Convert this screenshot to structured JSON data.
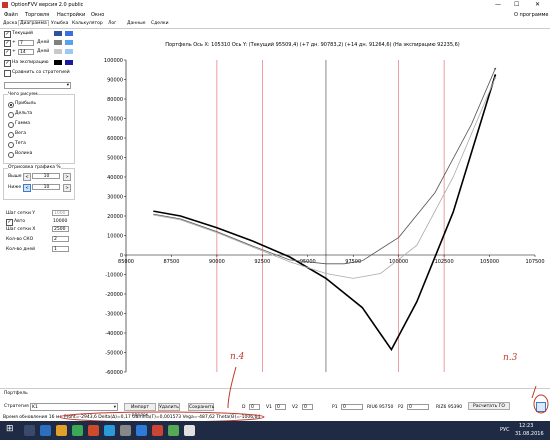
{
  "window": {
    "title": "OptionFVV версия 2.0 public",
    "minimize": "—",
    "maximize": "☐",
    "close": "✕"
  },
  "menu": {
    "items": [
      "Файл",
      "Торговля",
      "Настройки",
      "Окно"
    ],
    "about": "О программе"
  },
  "tabs": [
    "Доска",
    "Диаграмма",
    "Улыбка",
    "Калькулятор",
    "Лог",
    "Данные",
    "Сделки"
  ],
  "left_panel": {
    "current_label": "Текущий",
    "plus1": "+",
    "days1_value": "7",
    "days1_label": "Дней",
    "plus2": "+",
    "days2_value": "14",
    "days2_label": "Дней",
    "expiry_label": "На экспирацию",
    "compare_label": "Сравнить со стратегией",
    "whatdraw_label": "Чего рисуем",
    "radio_options": [
      "Прибыль",
      "Дельта",
      "Гамма",
      "Вега",
      "Тета",
      "Волина"
    ],
    "selected_radio": "Прибыль",
    "trim_label": "Отрисовка графика %",
    "above_label": "Выше",
    "above_value": "10",
    "below_label": "Ниже",
    "below_value": "10",
    "grid_y_label": "Шаг сетки Y",
    "grid_y_value": "1000",
    "auto_label": "Авто",
    "auto_value": "10000",
    "grid_x_label": "Шаг сетки X",
    "grid_x_value": "2500",
    "std_label": "Кол-во СКО",
    "std_value": "2",
    "days_count_label": "Кол-во дней",
    "days_count_value": "1",
    "colors": {
      "current": "#2f4f9f",
      "d7": "#7f7f7f",
      "d14": "#c8c8c8",
      "expiry": "#000000"
    }
  },
  "chart_header": "Портфель  Ось X:  105310 Ось Y:   (Текущий 95509,4)   (+7 дн. 90783,2)   (+14 дн. 91264,6)   (На экспирацию 92235,6)",
  "chart_data": {
    "type": "line",
    "x_ticks": [
      "85000",
      "87500",
      "90000",
      "92500",
      "95000",
      "97500",
      "100000",
      "102500",
      "105000",
      "107500"
    ],
    "y_ticks": [
      "100000",
      "90000",
      "80000",
      "70000",
      "60000",
      "50000",
      "40000",
      "30000",
      "20000",
      "10000",
      "0",
      "-10000",
      "-20000",
      "-30000",
      "-40000",
      "-50000",
      "-60000"
    ],
    "xlim": [
      85000,
      107500
    ],
    "ylim": [
      -60000,
      100000
    ],
    "vlines_red": [
      90000,
      92500,
      100000,
      102500
    ],
    "vline_current": 96000,
    "series": [
      {
        "color": "#000000",
        "width": 1.6,
        "x": [
          86500,
          88000,
          90000,
          92000,
          94000,
          96000,
          98000,
          99600,
          101000,
          103000,
          105310
        ],
        "y": [
          22500,
          20000,
          14000,
          7000,
          -1000,
          -12000,
          -27000,
          -48500,
          -24000,
          22000,
          92200
        ]
      },
      {
        "color": "#555555",
        "width": 0.8,
        "x": [
          86500,
          88000,
          90000,
          92000,
          94000,
          96000,
          97000,
          98000,
          100000,
          102000,
          104000,
          105310
        ],
        "y": [
          21000,
          18500,
          12000,
          4500,
          -2500,
          -4500,
          -4500,
          -3000,
          9000,
          32000,
          67000,
          95500
        ]
      },
      {
        "color": "#aaaaaa",
        "width": 0.8,
        "x": [
          86500,
          88000,
          90000,
          92000,
          94000,
          96000,
          97500,
          99000,
          101000,
          103000,
          105310
        ],
        "y": [
          20500,
          18000,
          11500,
          4000,
          -3500,
          -9500,
          -12000,
          -9500,
          5000,
          40000,
          90800
        ]
      }
    ]
  },
  "bottom": {
    "portfolio_label": "Портфель",
    "strategy_label": "Стратегия",
    "strategy_value": "K1",
    "btn_import": "Импорт сделок",
    "btn_delete": "Удалить",
    "btn_save": "Сохранить",
    "d_label": "D",
    "d_value": "0",
    "v1_label": "V1",
    "v1_value": "0",
    "v2_label": "V2",
    "v2_value": "0",
    "p1_label": "P1",
    "p1_value": "0",
    "ri1_label": "RIU6 95750",
    "p2_label": "P2",
    "p2_value": "0",
    "ri2_label": "RIZ6 95390",
    "btn_calc": "Расчитать ГО",
    "status_prefix": "Время обновления 16 мс",
    "status_greeks": "Profit=-2943,6 Delta(Δ)=0,17 Gamma(Γ)=0,001573 Vega=-487,62 Theta(Θ)=-1006,64"
  },
  "annotations": {
    "n4": "n.4",
    "n3": "n.3"
  },
  "taskbar": {
    "lang": "РУС",
    "time": "12:23",
    "date": "31.08.2016"
  }
}
